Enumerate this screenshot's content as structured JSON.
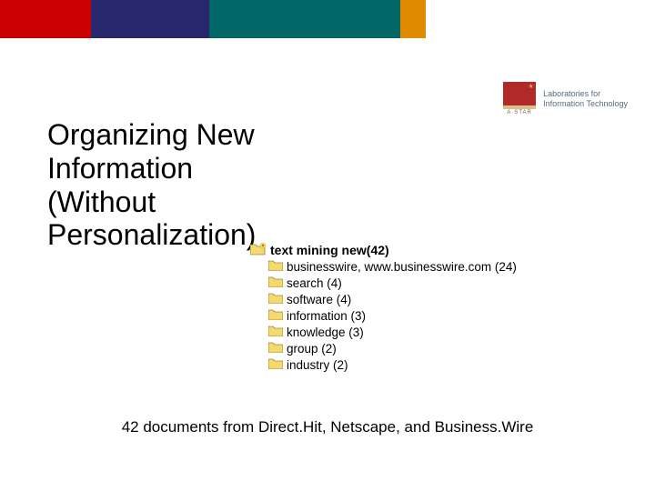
{
  "brand": {
    "logo_label": "A·STAR",
    "logo_text_line1": "Laboratories for",
    "logo_text_line2": "Information Technology"
  },
  "title": "Organizing New Information (Without Personalization)",
  "tree": {
    "root": "text mining new(42)",
    "items": [
      "businesswire, www.businesswire.com (24)",
      "search (4)",
      "software (4)",
      "information (3)",
      "knowledge (3)",
      "group (2)",
      "industry (2)"
    ]
  },
  "caption": "42 documents from Direct.Hit, Netscape, and Business.Wire"
}
